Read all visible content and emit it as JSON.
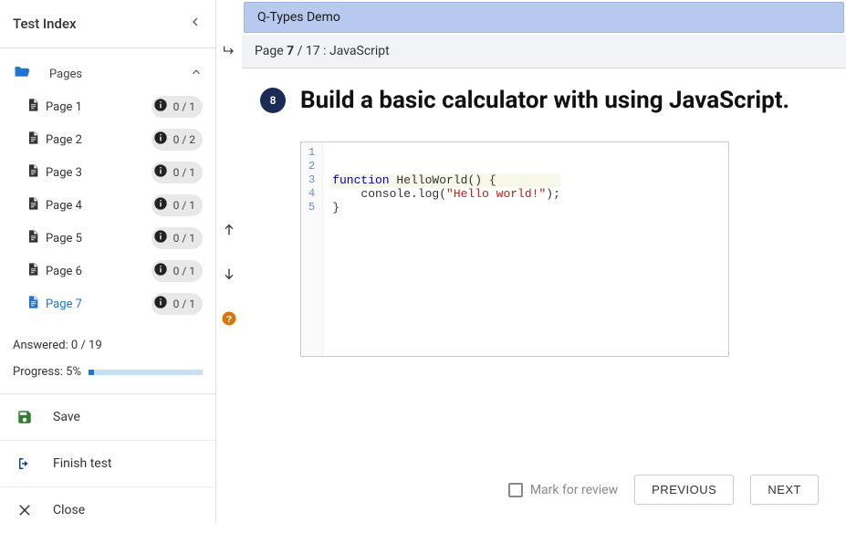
{
  "sidebar": {
    "title": "Test Index",
    "pages_label": "Pages",
    "items": [
      {
        "label": "Page 1",
        "badge": "0 / 1",
        "active": false
      },
      {
        "label": "Page 2",
        "badge": "0 / 2",
        "active": false
      },
      {
        "label": "Page 3",
        "badge": "0 / 1",
        "active": false
      },
      {
        "label": "Page 4",
        "badge": "0 / 1",
        "active": false
      },
      {
        "label": "Page 5",
        "badge": "0 / 1",
        "active": false
      },
      {
        "label": "Page 6",
        "badge": "0 / 1",
        "active": false
      },
      {
        "label": "Page 7",
        "badge": "0 / 1",
        "active": true
      }
    ],
    "answered_label": "Answered: 0 / 19",
    "progress_label": "Progress: 5%",
    "progress_pct": 5,
    "actions": {
      "save": "Save",
      "finish": "Finish test",
      "close": "Close"
    }
  },
  "main": {
    "banner": "Q-Types Demo",
    "breadcrumb_prefix": "Page ",
    "breadcrumb_current": "7",
    "breadcrumb_suffix": " / 17 : JavaScript",
    "question_number": "8",
    "question_title": "Build a basic calculator with using JavaScript.",
    "footer": {
      "mark_label": "Mark for review",
      "prev": "PREVIOUS",
      "next": "NEXT"
    }
  },
  "editor": {
    "line_numbers": [
      "1",
      "2",
      "3",
      "4",
      "5"
    ],
    "lines": [
      {
        "tokens": []
      },
      {
        "tokens": []
      },
      {
        "tokens": [
          {
            "t": "function ",
            "c": "kw"
          },
          {
            "t": "HelloWorld",
            "c": "fn"
          },
          {
            "t": "() {",
            "c": ""
          }
        ],
        "hl": true
      },
      {
        "tokens": [
          {
            "t": "    console.",
            "c": ""
          },
          {
            "t": "log",
            "c": "fn"
          },
          {
            "t": "(",
            "c": ""
          },
          {
            "t": "\"Hello world!\"",
            "c": "str"
          },
          {
            "t": ");",
            "c": ""
          }
        ]
      },
      {
        "tokens": [
          {
            "t": "}",
            "c": ""
          }
        ]
      }
    ]
  }
}
